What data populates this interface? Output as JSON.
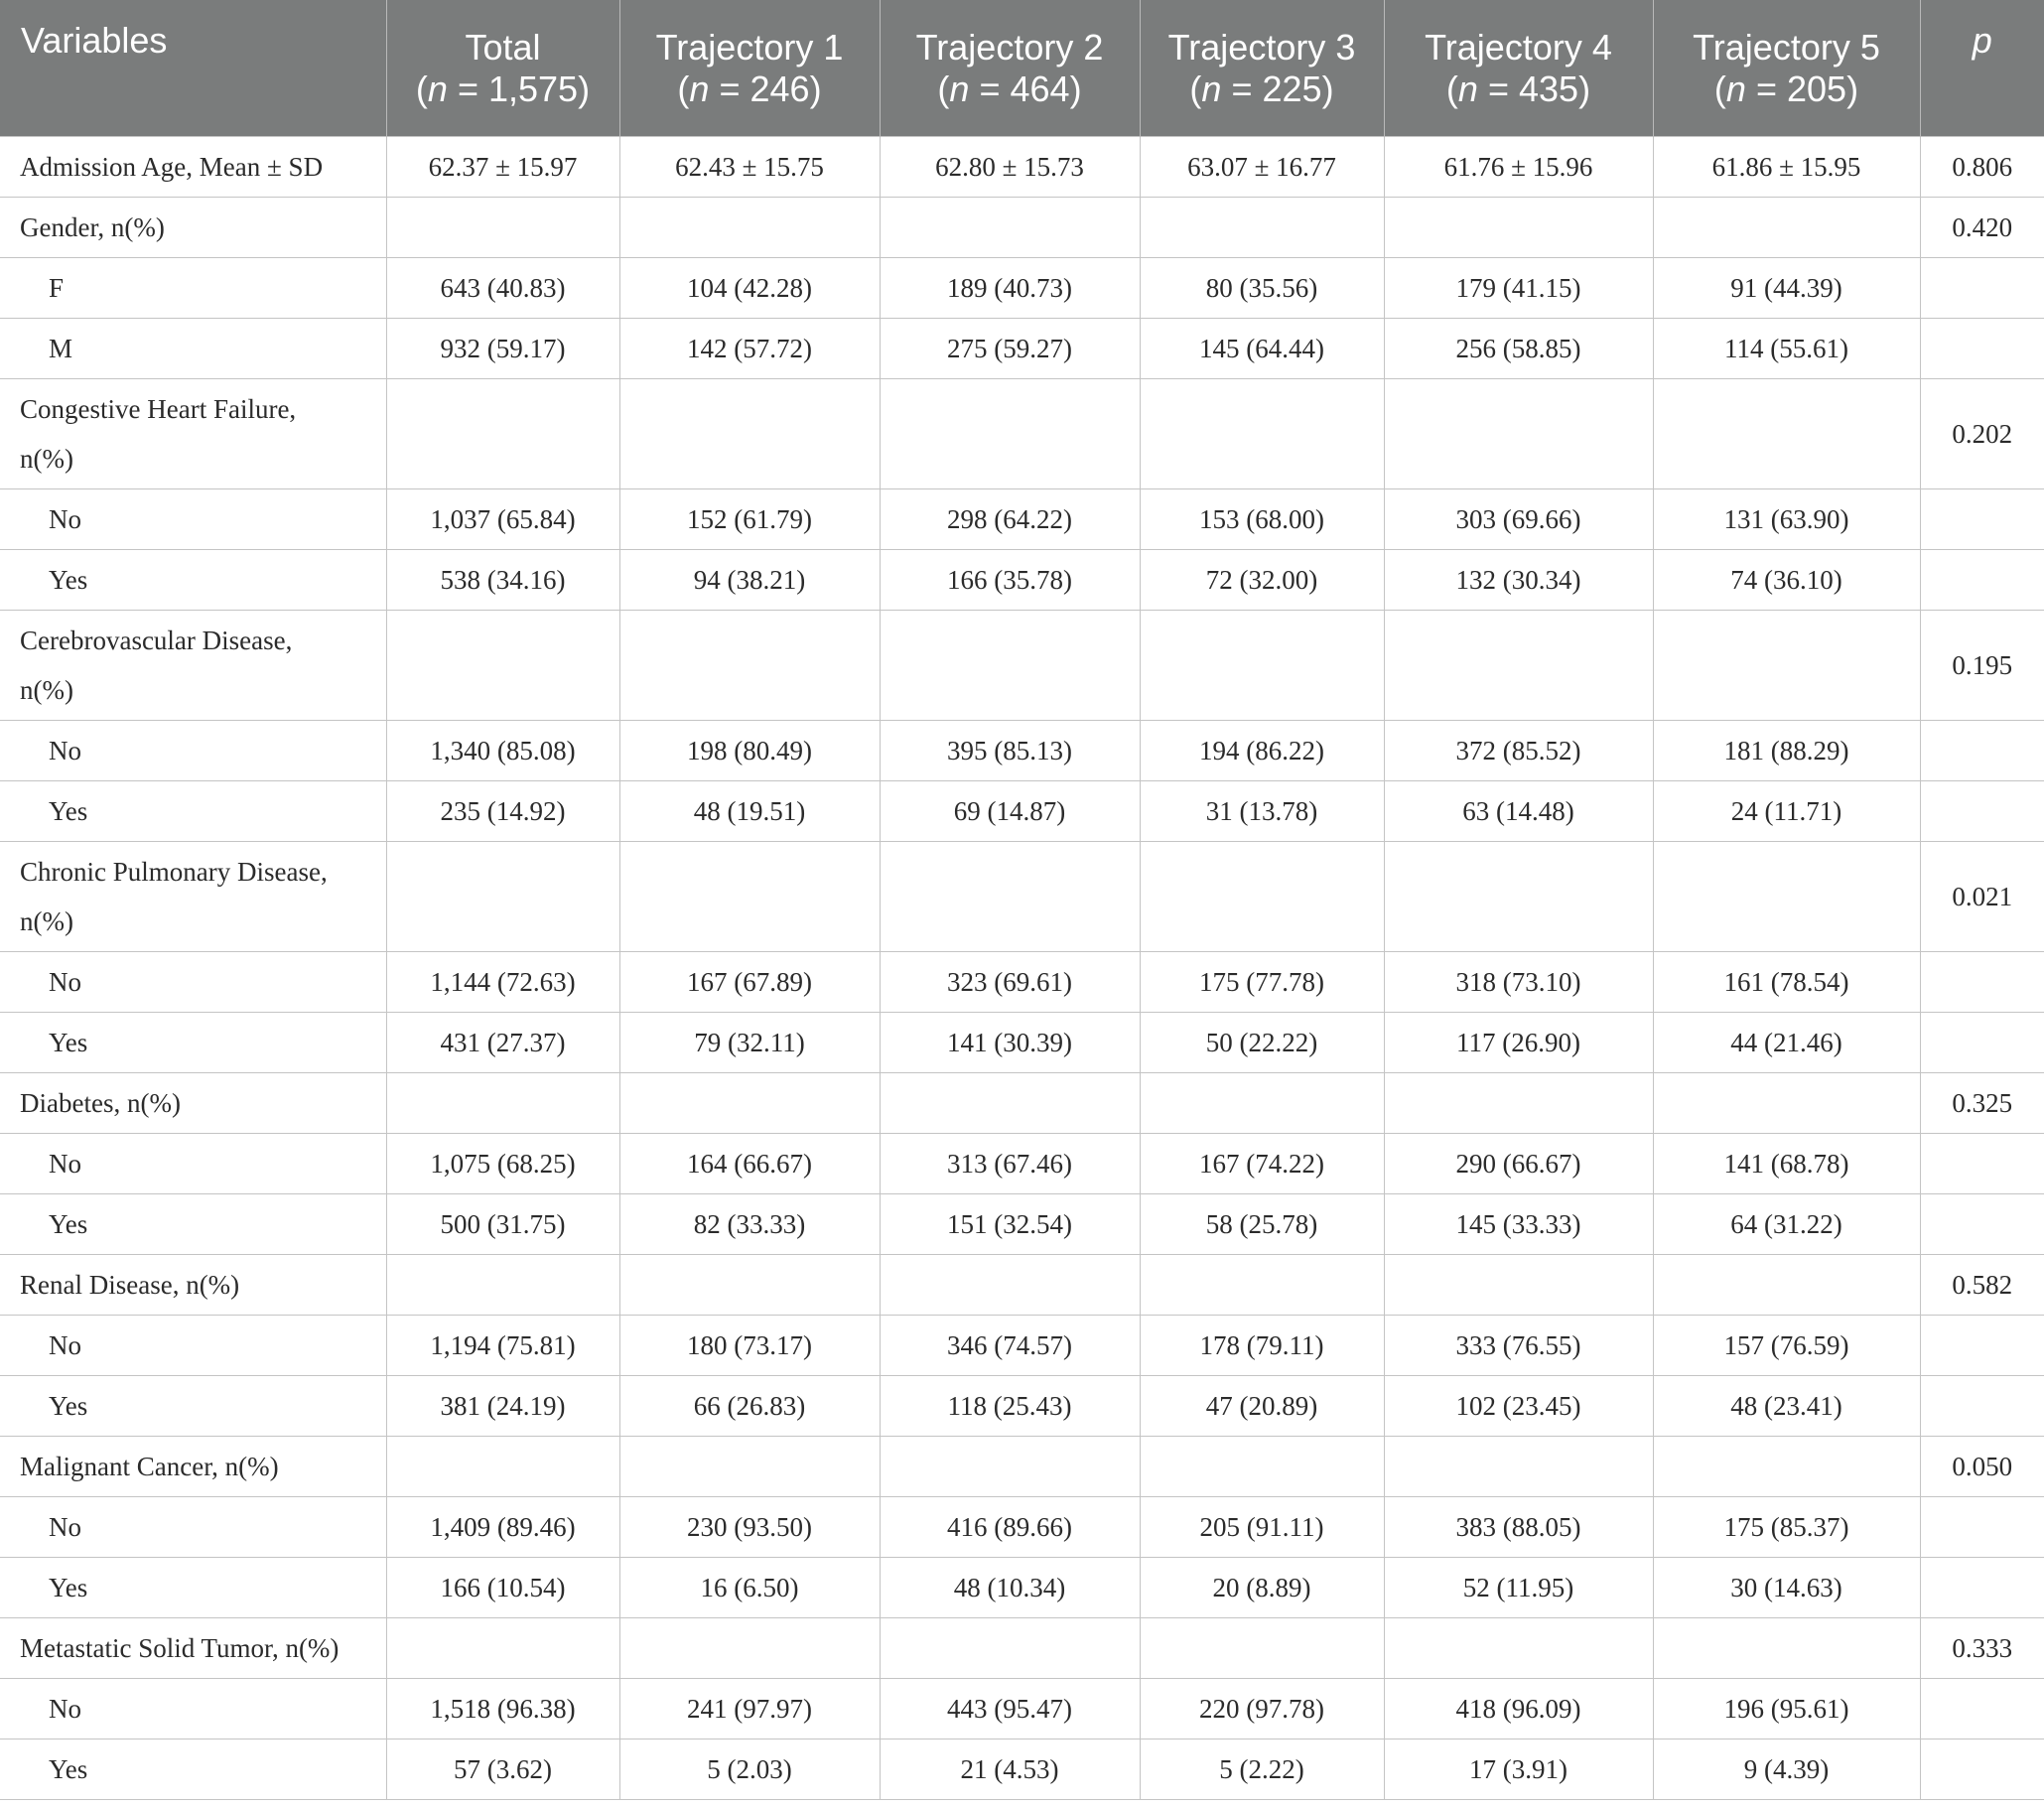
{
  "table": {
    "header": {
      "variables": "Variables",
      "total_label": "Total",
      "total_n": "1,575",
      "traj1_label": "Trajectory 1",
      "traj1_n": "246",
      "traj2_label": "Trajectory 2",
      "traj2_n": "464",
      "traj3_label": "Trajectory 3",
      "traj3_n": "225",
      "traj4_label": "Trajectory 4",
      "traj4_n": "435",
      "traj5_label": "Trajectory 5",
      "traj5_n": "205",
      "n_symbol": "n",
      "n_eq_open": "(",
      "n_eq_mid": " = ",
      "n_eq_close": ")",
      "p": "p"
    },
    "rows": [
      {
        "label": "Admission Age, Mean ± SD",
        "total": "62.37 ± 15.97",
        "t1": "62.43 ± 15.75",
        "t2": "62.80 ± 15.73",
        "t3": "63.07 ± 16.77",
        "t4": "61.76 ± 15.96",
        "t5": "61.86 ± 15.95",
        "p": "0.806"
      },
      {
        "label": "Gender, n(%)",
        "total": "",
        "t1": "",
        "t2": "",
        "t3": "",
        "t4": "",
        "t5": "",
        "p": "0.420"
      },
      {
        "label": "F",
        "total": "643 (40.83)",
        "t1": "104 (42.28)",
        "t2": "189 (40.73)",
        "t3": "80 (35.56)",
        "t4": "179 (41.15)",
        "t5": "91 (44.39)",
        "p": ""
      },
      {
        "label": "M",
        "total": "932 (59.17)",
        "t1": "142 (57.72)",
        "t2": "275 (59.27)",
        "t3": "145 (64.44)",
        "t4": "256 (58.85)",
        "t5": "114 (55.61)",
        "p": ""
      },
      {
        "label_line1": "Congestive Heart Failure,",
        "label_line2": "n(%)",
        "total": "",
        "t1": "",
        "t2": "",
        "t3": "",
        "t4": "",
        "t5": "",
        "p": "0.202"
      },
      {
        "label": "No",
        "total": "1,037 (65.84)",
        "t1": "152 (61.79)",
        "t2": "298 (64.22)",
        "t3": "153 (68.00)",
        "t4": "303 (69.66)",
        "t5": "131 (63.90)",
        "p": ""
      },
      {
        "label": "Yes",
        "total": "538 (34.16)",
        "t1": "94 (38.21)",
        "t2": "166 (35.78)",
        "t3": "72 (32.00)",
        "t4": "132 (30.34)",
        "t5": "74 (36.10)",
        "p": ""
      },
      {
        "label_line1": "Cerebrovascular Disease,",
        "label_line2": "n(%)",
        "total": "",
        "t1": "",
        "t2": "",
        "t3": "",
        "t4": "",
        "t5": "",
        "p": "0.195"
      },
      {
        "label": "No",
        "total": "1,340 (85.08)",
        "t1": "198 (80.49)",
        "t2": "395 (85.13)",
        "t3": "194 (86.22)",
        "t4": "372 (85.52)",
        "t5": "181 (88.29)",
        "p": ""
      },
      {
        "label": "Yes",
        "total": "235 (14.92)",
        "t1": "48 (19.51)",
        "t2": "69 (14.87)",
        "t3": "31 (13.78)",
        "t4": "63 (14.48)",
        "t5": "24 (11.71)",
        "p": ""
      },
      {
        "label_line1": "Chronic Pulmonary Disease,",
        "label_line2": "n(%)",
        "total": "",
        "t1": "",
        "t2": "",
        "t3": "",
        "t4": "",
        "t5": "",
        "p": "0.021"
      },
      {
        "label": "No",
        "total": "1,144 (72.63)",
        "t1": "167 (67.89)",
        "t2": "323 (69.61)",
        "t3": "175 (77.78)",
        "t4": "318 (73.10)",
        "t5": "161 (78.54)",
        "p": ""
      },
      {
        "label": "Yes",
        "total": "431 (27.37)",
        "t1": "79 (32.11)",
        "t2": "141 (30.39)",
        "t3": "50 (22.22)",
        "t4": "117 (26.90)",
        "t5": "44 (21.46)",
        "p": ""
      },
      {
        "label": "Diabetes, n(%)",
        "total": "",
        "t1": "",
        "t2": "",
        "t3": "",
        "t4": "",
        "t5": "",
        "p": "0.325"
      },
      {
        "label": "No",
        "total": "1,075 (68.25)",
        "t1": "164 (66.67)",
        "t2": "313 (67.46)",
        "t3": "167 (74.22)",
        "t4": "290 (66.67)",
        "t5": "141 (68.78)",
        "p": ""
      },
      {
        "label": "Yes",
        "total": "500 (31.75)",
        "t1": "82 (33.33)",
        "t2": "151 (32.54)",
        "t3": "58 (25.78)",
        "t4": "145 (33.33)",
        "t5": "64 (31.22)",
        "p": ""
      },
      {
        "label": "Renal Disease, n(%)",
        "total": "",
        "t1": "",
        "t2": "",
        "t3": "",
        "t4": "",
        "t5": "",
        "p": "0.582"
      },
      {
        "label": "No",
        "total": "1,194 (75.81)",
        "t1": "180 (73.17)",
        "t2": "346 (74.57)",
        "t3": "178 (79.11)",
        "t4": "333 (76.55)",
        "t5": "157 (76.59)",
        "p": ""
      },
      {
        "label": "Yes",
        "total": "381 (24.19)",
        "t1": "66 (26.83)",
        "t2": "118 (25.43)",
        "t3": "47 (20.89)",
        "t4": "102 (23.45)",
        "t5": "48 (23.41)",
        "p": ""
      },
      {
        "label": "Malignant Cancer, n(%)",
        "total": "",
        "t1": "",
        "t2": "",
        "t3": "",
        "t4": "",
        "t5": "",
        "p": "0.050"
      },
      {
        "label": "No",
        "total": "1,409 (89.46)",
        "t1": "230 (93.50)",
        "t2": "416 (89.66)",
        "t3": "205 (91.11)",
        "t4": "383 (88.05)",
        "t5": "175 (85.37)",
        "p": ""
      },
      {
        "label": "Yes",
        "total": "166 (10.54)",
        "t1": "16 (6.50)",
        "t2": "48 (10.34)",
        "t3": "20 (8.89)",
        "t4": "52 (11.95)",
        "t5": "30 (14.63)",
        "p": ""
      },
      {
        "label": "Metastatic Solid Tumor, n(%)",
        "total": "",
        "t1": "",
        "t2": "",
        "t3": "",
        "t4": "",
        "t5": "",
        "p": "0.333"
      },
      {
        "label": "No",
        "total": "1,518 (96.38)",
        "t1": "241 (97.97)",
        "t2": "443 (95.47)",
        "t3": "220 (97.78)",
        "t4": "418 (96.09)",
        "t5": "196 (95.61)",
        "p": ""
      },
      {
        "label": "Yes",
        "total": "57 (3.62)",
        "t1": "5 (2.03)",
        "t2": "21 (4.53)",
        "t3": "5 (2.22)",
        "t4": "17 (3.91)",
        "t5": "9 (4.39)",
        "p": ""
      }
    ]
  },
  "colors": {
    "header_bg": "#7a7c7c",
    "header_text": "#ffffff",
    "grid": "#c4c4c4",
    "body_text": "#2b2b2b"
  }
}
